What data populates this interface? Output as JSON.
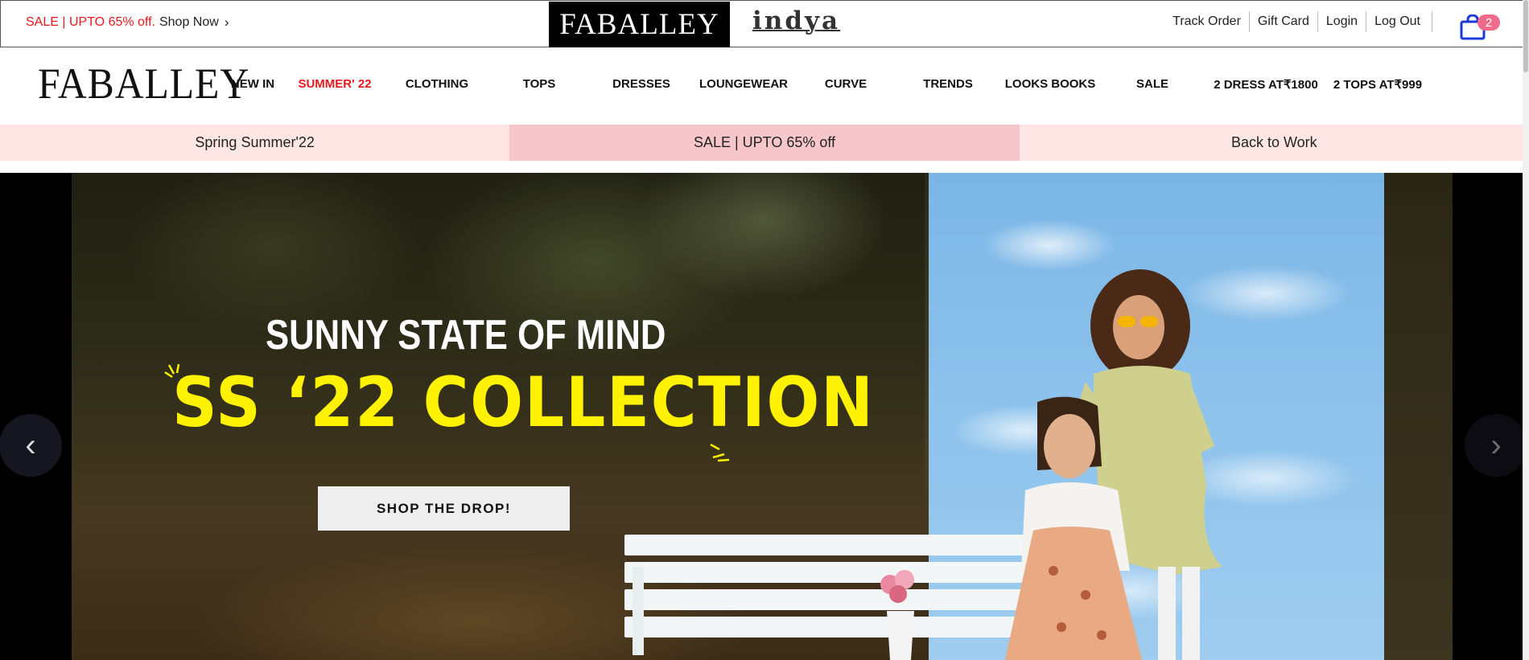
{
  "topbar": {
    "sale_text": "SALE | UPTO 65% off.",
    "shop_now": "Shop Now",
    "chevron": "›",
    "brands": {
      "primary": "FABALLEY",
      "secondary": "indya"
    },
    "account_links": [
      "Track Order",
      "Gift Card",
      "Login",
      "Log Out"
    ],
    "cart_count": "2"
  },
  "nav": {
    "logo": "FABALLEY",
    "items": [
      {
        "label": "NEW IN",
        "hot": false
      },
      {
        "label": "SUMMER' 22",
        "hot": true
      },
      {
        "label": "CLOTHING",
        "hot": false
      },
      {
        "label": "TOPS",
        "hot": false
      },
      {
        "label": "DRESSES",
        "hot": false
      },
      {
        "label": "LOUNGEWEAR",
        "hot": false
      },
      {
        "label": "CURVE",
        "hot": false
      },
      {
        "label": "TRENDS",
        "hot": false
      },
      {
        "label": "LOOKS BOOKS",
        "hot": false
      },
      {
        "label": "SALE",
        "hot": false
      },
      {
        "label": "2 DRESS AT₹1800",
        "hot": false
      },
      {
        "label": "2 TOPS AT₹999",
        "hot": false
      }
    ]
  },
  "categories": [
    "Spring Summer'22",
    "SALE | UPTO 65% off",
    "Back to Work"
  ],
  "hero": {
    "tagline": "SUNNY STATE OF MIND",
    "headline": "SS ‘22 COLLECTION",
    "cta": "SHOP THE DROP!",
    "prev": "‹",
    "next": "›"
  },
  "colors": {
    "sale_red": "#e4191f",
    "badge_pink": "#f06b8b",
    "cart_blue": "#1a3bd6",
    "strip_light": "#fde6e4",
    "strip_mid": "#f7c6ca",
    "headline_yellow": "#fff200"
  },
  "icons": {
    "cart": "shopping-bag-icon",
    "prev": "chevron-left-icon",
    "next": "chevron-right-icon"
  }
}
